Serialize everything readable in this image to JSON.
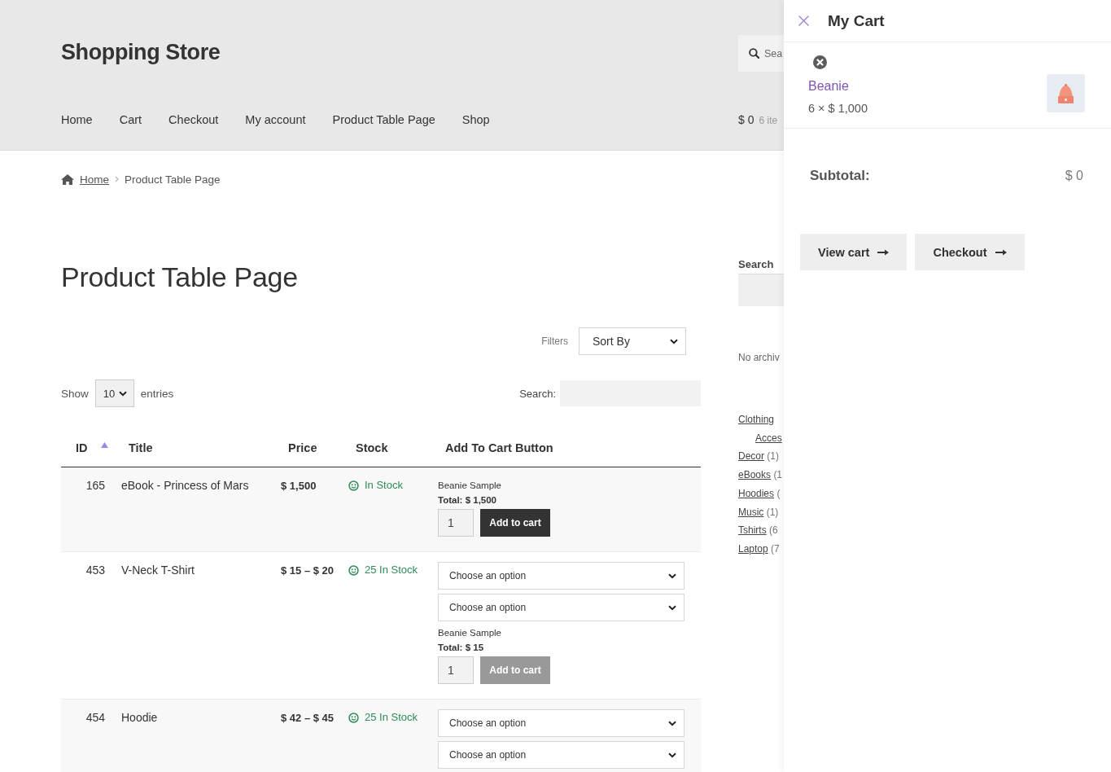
{
  "header": {
    "site_title": "Shopping Store",
    "nav": [
      {
        "label": "Home"
      },
      {
        "label": "Cart"
      },
      {
        "label": "Checkout"
      },
      {
        "label": "My account"
      },
      {
        "label": "Product Table Page"
      },
      {
        "label": "Shop"
      }
    ],
    "search": {
      "placeholder": "Sea"
    },
    "cart_total": "$ 0",
    "cart_count": "6 ite"
  },
  "breadcrumb": [
    {
      "label": "Home",
      "kind": "link"
    },
    {
      "label": "Product Table Page",
      "kind": "current"
    }
  ],
  "page_title": "Product Table Page",
  "filters": {
    "label": "Filters",
    "sort": "Sort By"
  },
  "entries": {
    "show_label": "Show",
    "value": "10",
    "suffix": "entries",
    "search_label": "Search:"
  },
  "table": {
    "columns": [
      {
        "label": "ID",
        "sorted": true
      },
      {
        "label": "Title",
        "sorted": false
      },
      {
        "label": "Price",
        "sorted": false
      },
      {
        "label": "Stock",
        "sorted": false
      },
      {
        "label": "Add To Cart Button",
        "sorted": false
      }
    ],
    "rows": [
      {
        "id": "165",
        "title": "eBook - Princess of Mars",
        "price": "$ 1,500",
        "stock": "In Stock",
        "sample": "Beanie Sample",
        "total": "Total: $ 1,500",
        "quantity": "1",
        "button": {
          "label": "Add to cart",
          "disabled": false
        }
      },
      {
        "id": "453",
        "title": "V-Neck T-Shirt",
        "price": "$ 15 – $ 20",
        "stock": "25 In Stock",
        "options": [
          "Choose an option",
          "Choose an option"
        ],
        "sample": "Beanie Sample",
        "total": "Total: $ 15",
        "quantity": "1",
        "button": {
          "label": "Add to cart",
          "disabled": true
        }
      },
      {
        "id": "454",
        "title": "Hoodie",
        "price": "$ 42 – $ 45",
        "stock": "25 In Stock",
        "options": [
          "Choose an option",
          "Choose an option"
        ]
      }
    ]
  },
  "sidebar": {
    "search_heading": "Search",
    "archives": "No archiv",
    "categories": [
      {
        "name": "Clothing",
        "children": [
          {
            "name": "Acces"
          }
        ]
      },
      {
        "name": "Decor",
        "count": "(1)"
      },
      {
        "name": "eBooks",
        "count": "(1"
      },
      {
        "name": "Hoodies",
        "count": "("
      },
      {
        "name": "Music",
        "count": "(1)"
      },
      {
        "name": "Tshirts",
        "count": "(6"
      },
      {
        "name": "Laptop",
        "count": "(7"
      }
    ]
  },
  "cart": {
    "title": "My Cart",
    "items": [
      {
        "name": "Beanie",
        "line": "6 × $ 1,000"
      }
    ],
    "subtotal_label": "Subtotal:",
    "subtotal": "$ 0",
    "buttons": [
      {
        "label": "View cart"
      },
      {
        "label": "Checkout"
      }
    ]
  }
}
